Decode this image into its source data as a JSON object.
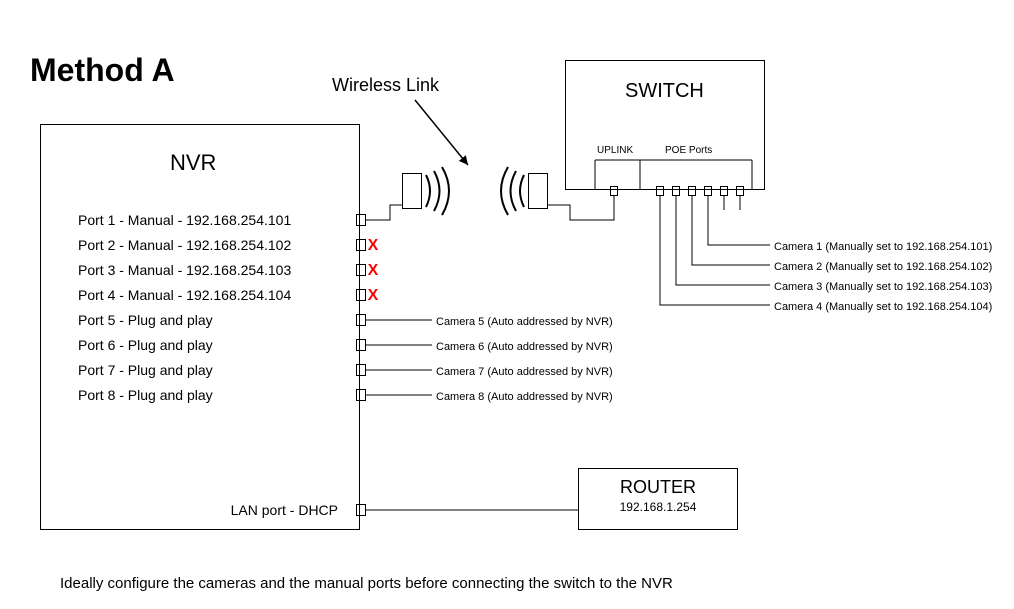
{
  "heading": "Method A",
  "wireless_label": "Wireless Link",
  "nvr": {
    "label": "NVR",
    "ports": [
      "Port 1 - Manual - 192.168.254.101",
      "Port 2 - Manual - 192.168.254.102",
      "Port 3 - Manual - 192.168.254.103",
      "Port 4 - Manual - 192.168.254.104",
      "Port 5 - Plug and play",
      "Port 6 - Plug and play",
      "Port 7 - Plug and play",
      "Port 8 - Plug and play"
    ],
    "lan_port": "LAN port - DHCP"
  },
  "x_mark": "X",
  "local_cameras": [
    "Camera 5 (Auto addressed by NVR)",
    "Camera 6 (Auto addressed by NVR)",
    "Camera 7 (Auto addressed by NVR)",
    "Camera 8 (Auto addressed by NVR)"
  ],
  "switch": {
    "label": "SWITCH",
    "uplink": "UPLINK",
    "poe": "POE Ports"
  },
  "remote_cameras": [
    "Camera 1 (Manually set to 192.168.254.101)",
    "Camera 2 (Manually set to 192.168.254.102)",
    "Camera 3 (Manually set to 192.168.254.103)",
    "Camera 4 (Manually set to 192.168.254.104)"
  ],
  "router": {
    "label": "ROUTER",
    "ip": "192.168.1.254"
  },
  "footer": "Ideally configure the cameras and the manual ports before connecting the switch to the NVR"
}
